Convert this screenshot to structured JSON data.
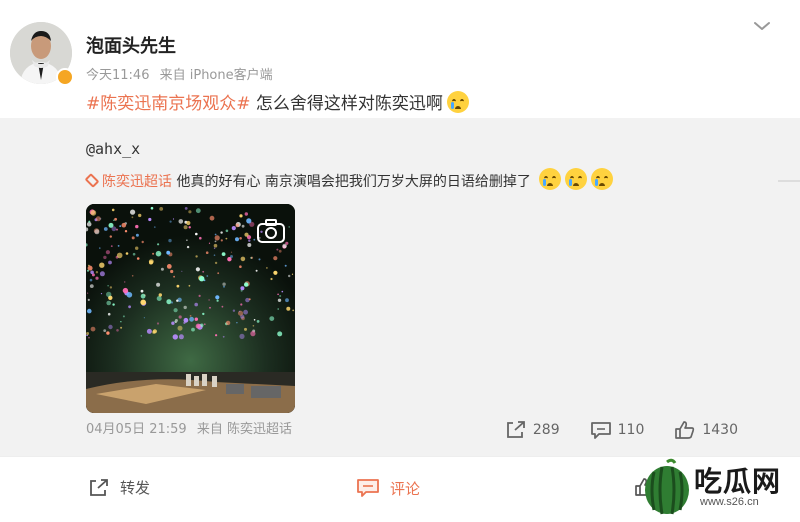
{
  "post": {
    "author": "泡面头先生",
    "time": "今天11:46",
    "source": "来自 iPhone客户端",
    "topic": "#陈奕迅南京场观众#",
    "text": " 怎么舍得这样对陈奕迅啊",
    "emoji": "cry-emoji"
  },
  "repost": {
    "username": "@ahx_x",
    "supertopic": "陈奕迅超话",
    "text": " 他真的好有心 南京演唱会把我们万岁大屏的日语给删掉了",
    "emoji_count": 3,
    "date": "04月05日 21:59",
    "source": "来自 陈奕迅超话",
    "reposts": "289",
    "comments": "110",
    "likes": "1430"
  },
  "actions": {
    "repost_label": "转发",
    "comment_label": "评论"
  },
  "watermark": {
    "title": "吃瓜网",
    "url": "www.s26.cn"
  },
  "colors": {
    "accent": "#eb7350",
    "verify": "#f5a623",
    "meta_text": "#999999",
    "repost_background": "#f2f2f2"
  }
}
